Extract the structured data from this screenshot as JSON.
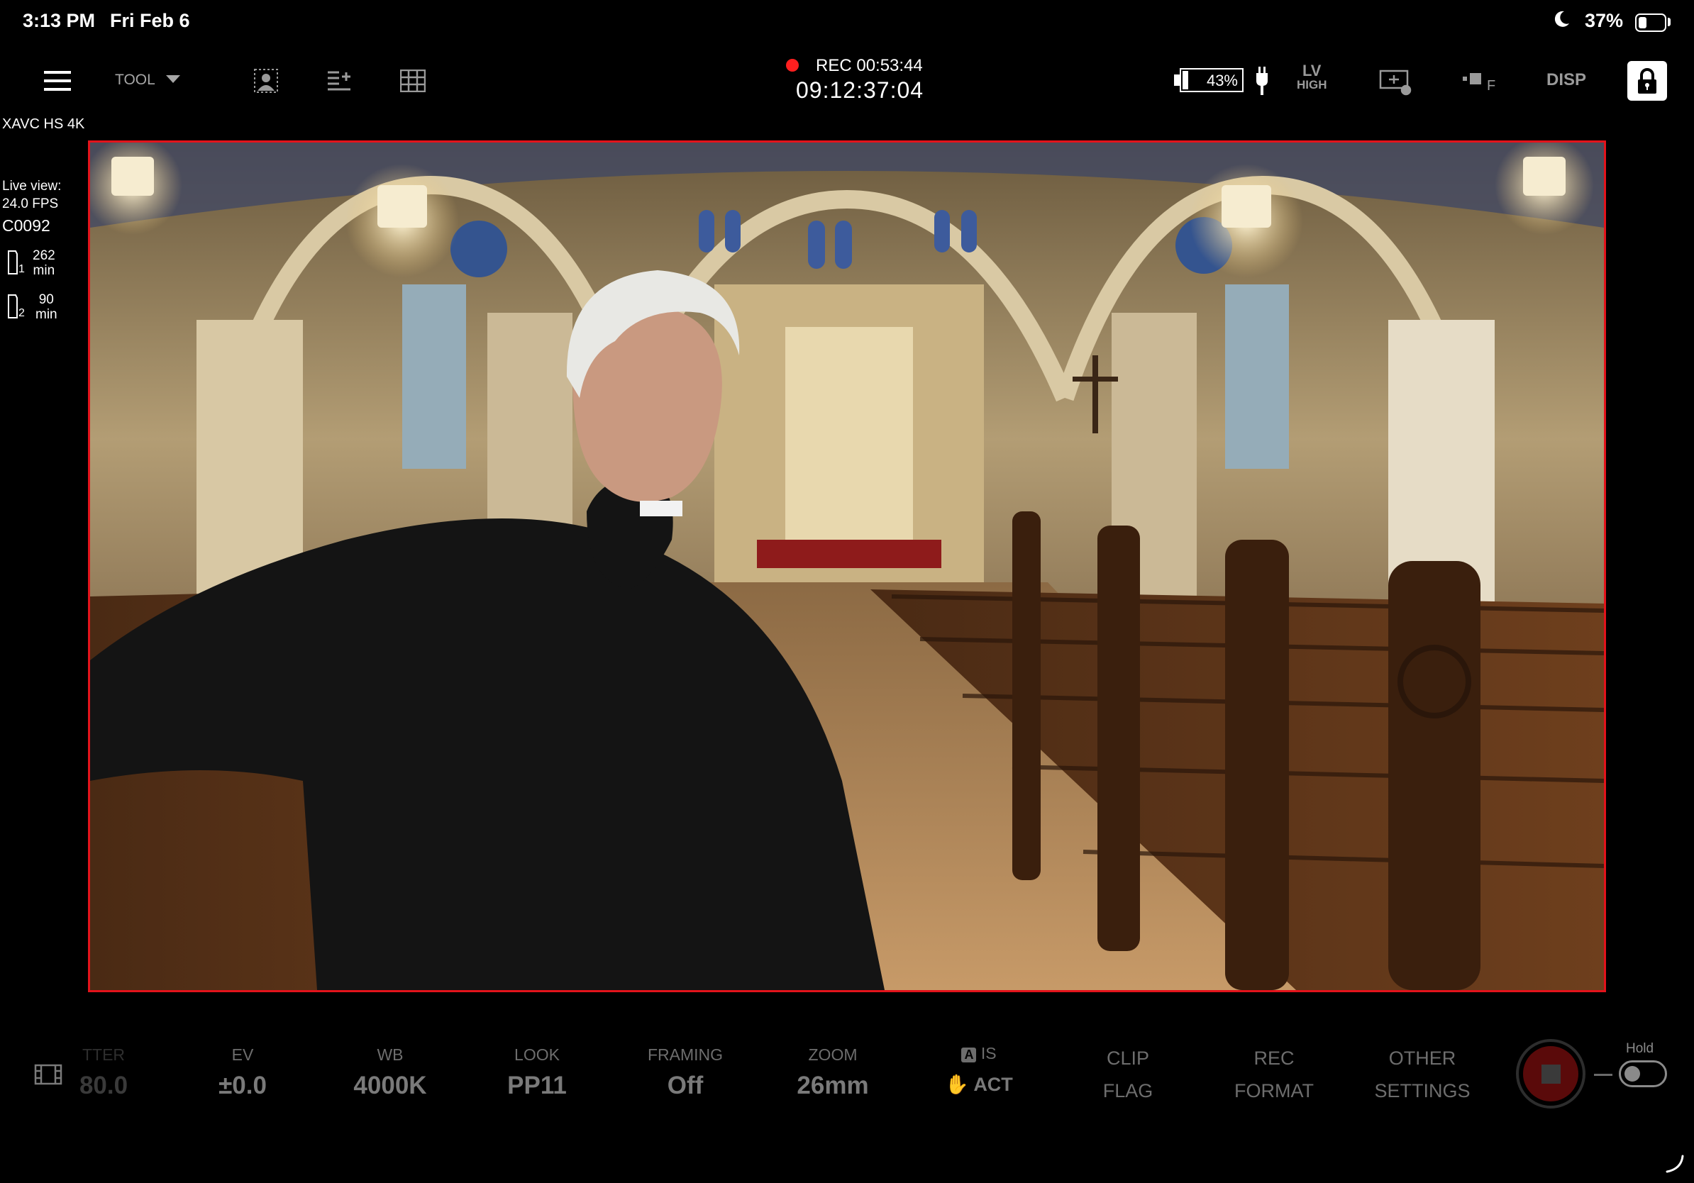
{
  "status_bar": {
    "time": "3:13 PM",
    "date": "Fri Feb 6",
    "battery_percent": "37%",
    "battery_level": 0.37,
    "focus_icon": "moon-icon"
  },
  "toolbar": {
    "tool_label": "TOOL",
    "recording": {
      "label": "REC 00:53:44",
      "timecode": "09:12:37:04",
      "dot_color": "#ff1f1f"
    },
    "camera_battery": "43%",
    "camera_battery_level": 0.43,
    "lv_top": "LV",
    "lv_bottom": "HIGH",
    "disp_label": "DISP"
  },
  "info_panel": {
    "codec": "XAVC HS 4K",
    "live_view_label": "Live view:",
    "live_view_fps": "24.0 FPS",
    "clip_name": "C0092",
    "slot1_value": "262",
    "slot1_unit": "min",
    "slot2_value": "90",
    "slot2_unit": "min"
  },
  "viewport": {
    "frame_color": "#e3131b"
  },
  "controls": {
    "shutter_label": "TTER",
    "shutter_value": "80.0",
    "ev_label": "EV",
    "ev_value": "±0.0",
    "wb_label": "WB",
    "wb_value": "4000K",
    "look_label": "LOOK",
    "look_value": "PP11",
    "framing_label": "FRAMING",
    "framing_value": "Off",
    "zoom_label": "ZOOM",
    "zoom_value": "26mm",
    "is_badge": "A",
    "is_label": "IS",
    "is_value": "ACT",
    "clip_flag_line1": "CLIP",
    "clip_flag_line2": "FLAG",
    "rec_format_line1": "REC",
    "rec_format_line2": "FORMAT",
    "other_settings_line1": "OTHER",
    "other_settings_line2": "SETTINGS",
    "hold_label": "Hold"
  }
}
